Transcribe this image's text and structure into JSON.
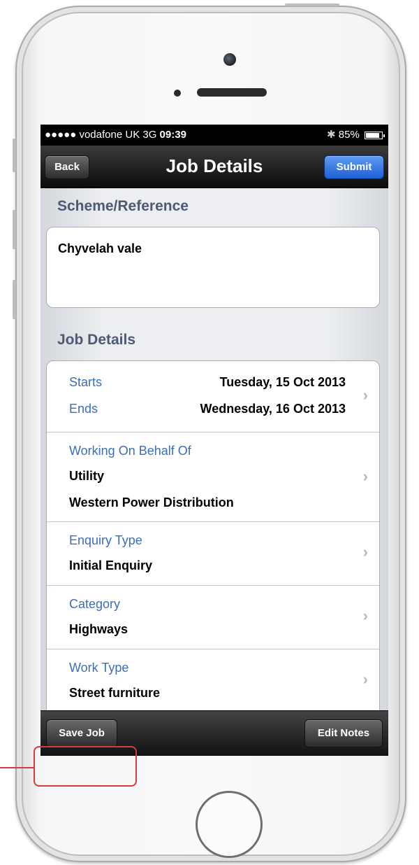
{
  "status_bar": {
    "signal": "●●●●● vodafone UK  3G",
    "time": "09:39",
    "bluetooth": "✱",
    "battery_percent": "85%"
  },
  "nav": {
    "title": "Job Details",
    "back_label": "Back",
    "submit_label": "Submit"
  },
  "scheme": {
    "header": "Scheme/Reference",
    "value": "Chyvelah vale"
  },
  "job_details": {
    "header": "Job Details",
    "starts_label": "Starts",
    "starts_value": "Tuesday, 15 Oct 2013",
    "ends_label": "Ends",
    "ends_value": "Wednesday, 16 Oct 2013",
    "behalf_label": "Working On Behalf Of",
    "behalf_value_1": "Utility",
    "behalf_value_2": "Western Power Distribution",
    "enquiry_label": "Enquiry Type",
    "enquiry_value": "Initial Enquiry",
    "category_label": "Category",
    "category_value": "Highways",
    "worktype_label": "Work Type",
    "worktype_value": "Street furniture"
  },
  "toolbar": {
    "save_label": "Save Job",
    "notes_label": "Edit Notes"
  },
  "colors": {
    "accent_blue": "#1e5fd6",
    "label_blue": "#3c6fb6",
    "annotation_red": "#d63a3a"
  }
}
